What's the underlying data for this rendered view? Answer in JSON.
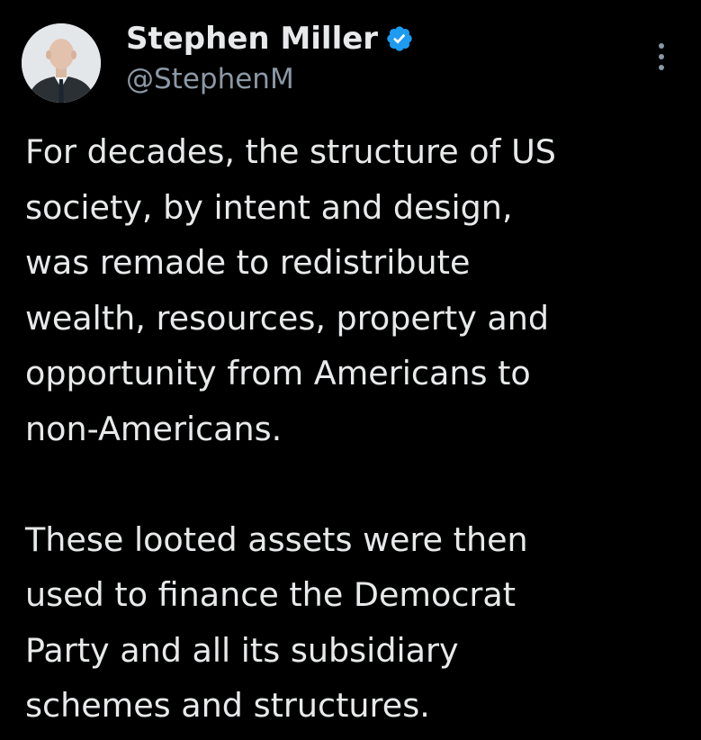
{
  "tweet": {
    "author": {
      "display_name": "Stephen Miller",
      "handle": "@StephenM",
      "verified": true,
      "verified_icon": "verified-badge-icon",
      "avatar_icon": "profile-photo",
      "badge_color": "#1d9bf0"
    },
    "menu_icon": "more-options-icon",
    "paragraphs": [
      "For decades, the structure of US\nsociety, by intent and design,\nwas remade to redistribute\nwealth, resources, property and\nopportunity from Americans to\nnon-Americans.",
      "These looted assets were then\nused to finance the Democrat\nParty and all its subsidiary\nschemes and structures."
    ]
  },
  "theme": {
    "background": "#000000",
    "text": "#e7e9ea",
    "secondary_text": "#8b98a5"
  }
}
